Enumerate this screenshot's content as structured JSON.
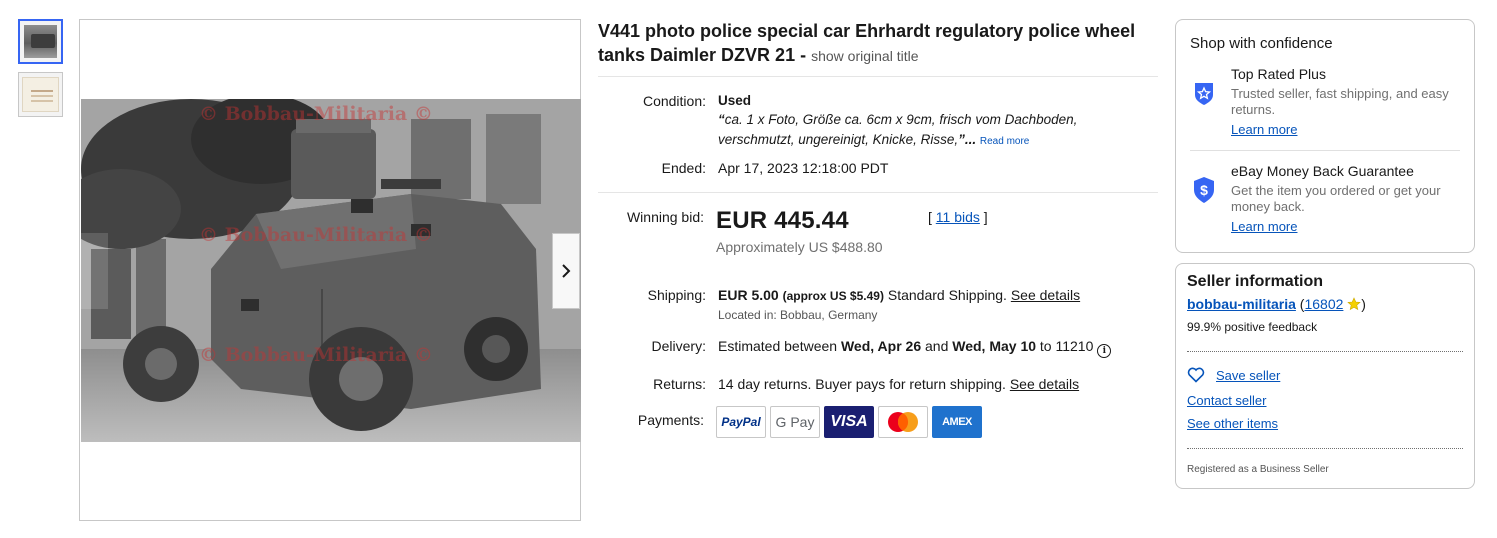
{
  "thumbnails": [
    {
      "alt": "photo front",
      "active": true
    },
    {
      "alt": "photo back",
      "active": false
    }
  ],
  "watermark": "© Bobbau-Militaria ©",
  "listing": {
    "title": "V441 photo police special car Ehrhardt regulatory police wheel tanks Daimler DZVR 21 -",
    "show_original": "show original title",
    "condition_label": "Condition:",
    "condition_value": "Used",
    "condition_quote_open": "“",
    "condition_quote": "ca. 1 x Foto, Größe ca. 6cm x 9cm, frisch vom Dachboden, verschmutzt, ungereinigt, Knicke, Risse,",
    "condition_quote_close": "”...",
    "read_more": "Read more",
    "ended_label": "Ended:",
    "ended_value": "Apr 17, 2023 12:18:00 PDT",
    "winning_label": "Winning bid:",
    "winning_value": "EUR 445.44",
    "bids_open": "[",
    "bids_link": "11 bids",
    "bids_close": "]",
    "approx": "Approximately US $488.80",
    "shipping_label": "Shipping:",
    "shipping_price": "EUR 5.00",
    "shipping_approx": "(approx US $5.49)",
    "shipping_method": "Standard Shipping.",
    "see_details": "See details",
    "located": "Located in: Bobbau, Germany",
    "delivery_label": "Delivery:",
    "delivery_pre": "Estimated between",
    "delivery_date1": "Wed, Apr 26",
    "delivery_and": "and",
    "delivery_date2": "Wed, May 10",
    "delivery_to": "to 11210",
    "returns_label": "Returns:",
    "returns_value": "14 day returns. Buyer pays for return shipping.",
    "returns_see": "See details",
    "payments_label": "Payments:",
    "payment_methods": [
      "PayPal",
      "G Pay",
      "VISA",
      "Mastercard",
      "AMEX"
    ]
  },
  "confidence": {
    "title": "Shop with confidence",
    "items": [
      {
        "heading": "Top Rated Plus",
        "text": "Trusted seller, fast shipping, and easy returns.",
        "link": "Learn more",
        "icon": "shield-star-icon"
      },
      {
        "heading": "eBay Money Back Guarantee",
        "text": "Get the item you ordered or get your money back.",
        "link": "Learn more",
        "icon": "shield-dollar-icon"
      }
    ]
  },
  "seller": {
    "title": "Seller information",
    "name": "bobbau-militaria",
    "score_open": "(",
    "score": "16802",
    "score_close": ")",
    "feedback": "99.9% positive feedback",
    "save": "Save seller",
    "contact": "Contact seller",
    "other": "See other items",
    "registered": "Registered as a Business Seller"
  },
  "colors": {
    "link": "#0654ba",
    "accent": "#3665f3",
    "text": "#191919",
    "muted": "#707070"
  }
}
